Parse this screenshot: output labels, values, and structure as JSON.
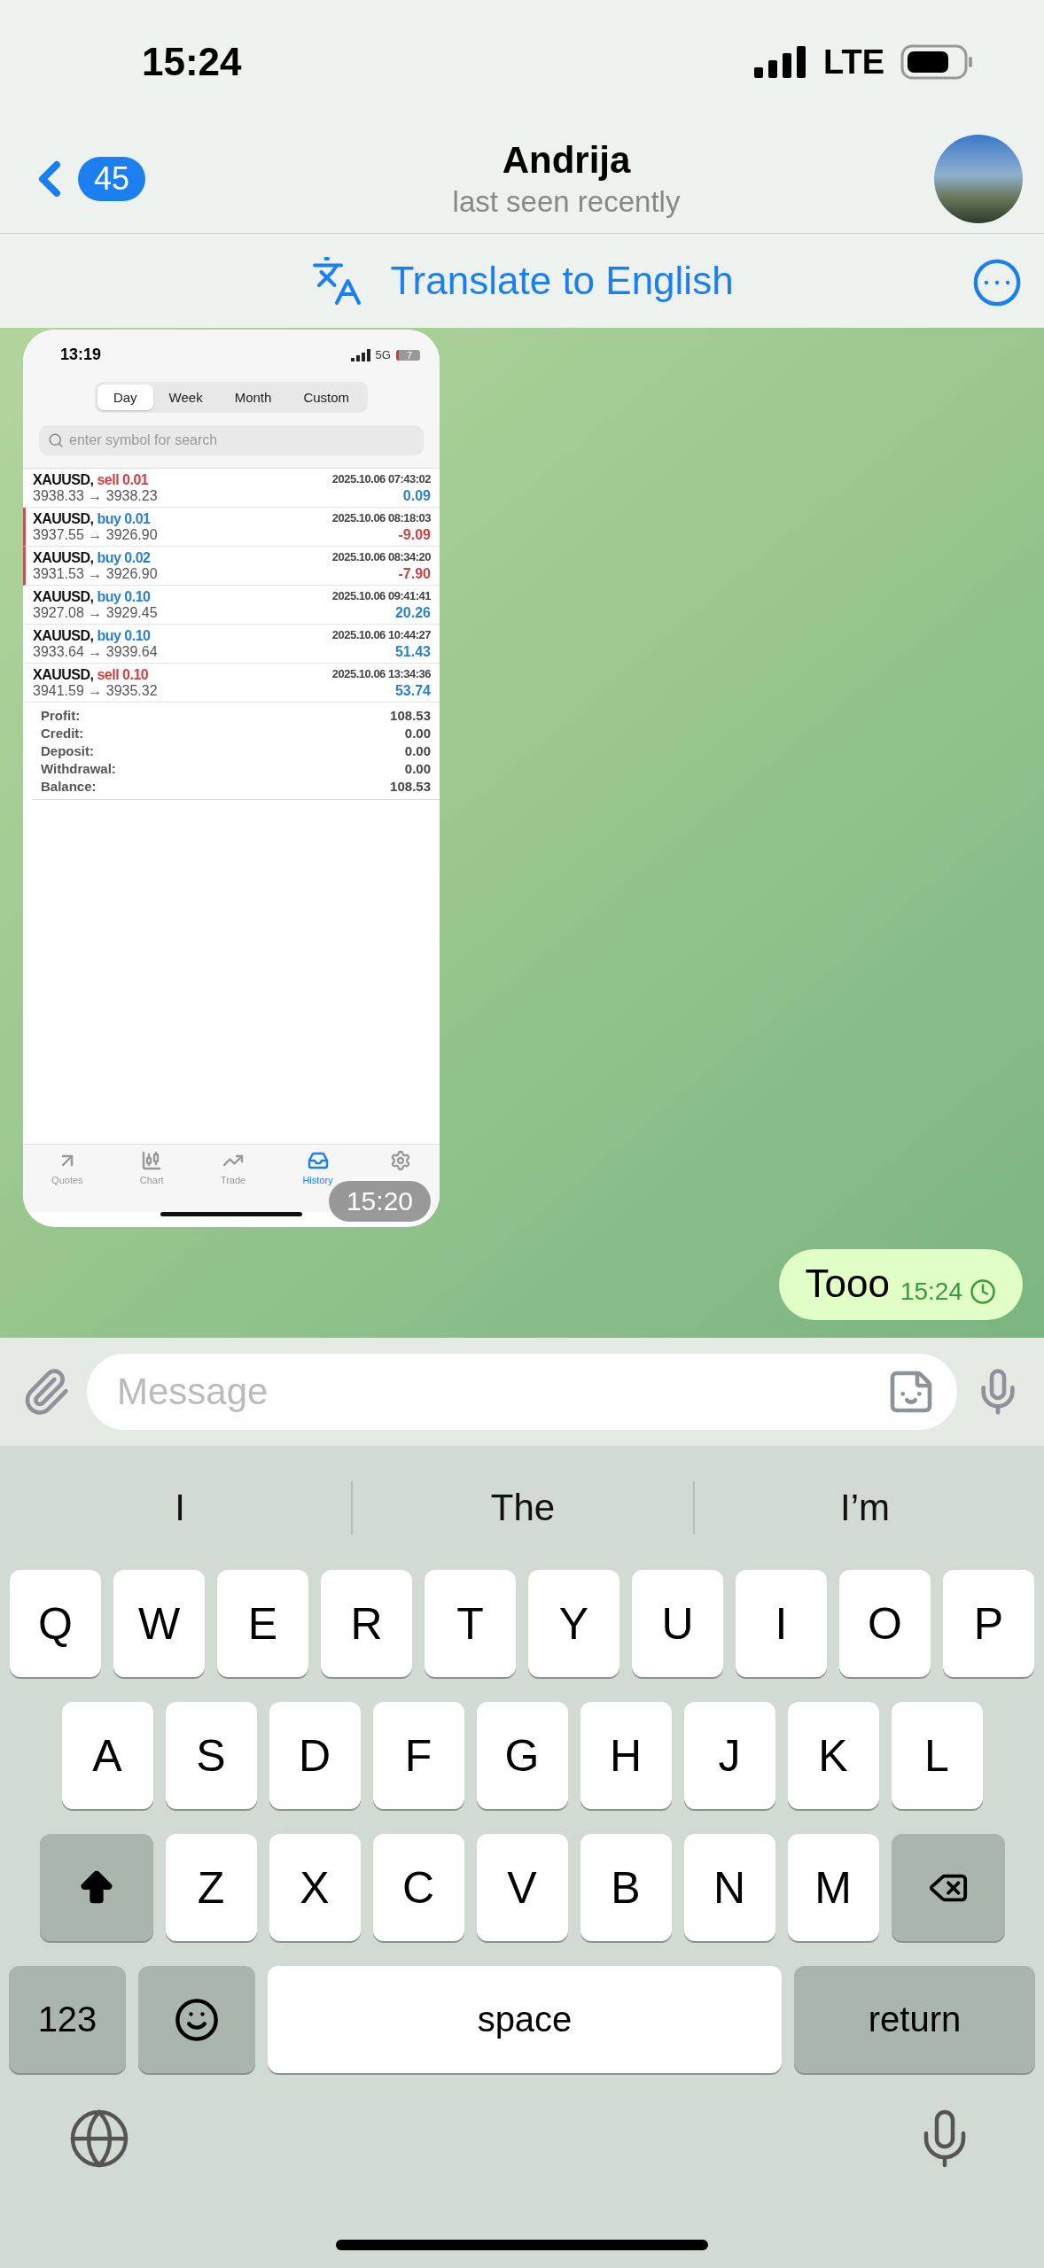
{
  "status_bar": {
    "time": "15:24",
    "network": "LTE"
  },
  "header": {
    "back_count": "45",
    "name": "Andrija",
    "subtitle": "last seen recently"
  },
  "translate_bar": {
    "label": "Translate to English"
  },
  "messages": [
    {
      "kind": "image",
      "time": "15:20",
      "screenshot": {
        "status_time": "13:19",
        "network": "5G",
        "battery": "7",
        "periods": [
          {
            "label": "Day",
            "selected": true
          },
          {
            "label": "Week",
            "selected": false
          },
          {
            "label": "Month",
            "selected": false
          },
          {
            "label": "Custom",
            "selected": false
          }
        ],
        "search": {
          "placeholder": "enter symbol for search"
        },
        "trades": [
          {
            "symbol": "XAUUSD,",
            "action": "sell 0.01",
            "is_sell": true,
            "time": "2025.10.06 07:43:02",
            "prices": "3938.33 → 3938.23",
            "profit": "0.09",
            "loss": false,
            "flagged": false
          },
          {
            "symbol": "XAUUSD,",
            "action": "buy 0.01",
            "is_sell": false,
            "time": "2025.10.06 08:18:03",
            "prices": "3937.55 → 3926.90",
            "profit": "-9.09",
            "loss": true,
            "flagged": true
          },
          {
            "symbol": "XAUUSD,",
            "action": "buy 0.02",
            "is_sell": false,
            "time": "2025.10.06 08:34:20",
            "prices": "3931.53 → 3926.90",
            "profit": "-7.90",
            "loss": true,
            "flagged": true
          },
          {
            "symbol": "XAUUSD,",
            "action": "buy 0.10",
            "is_sell": false,
            "time": "2025.10.06 09:41:41",
            "prices": "3927.08 → 3929.45",
            "profit": "20.26",
            "loss": false,
            "flagged": false
          },
          {
            "symbol": "XAUUSD,",
            "action": "buy 0.10",
            "is_sell": false,
            "time": "2025.10.06 10:44:27",
            "prices": "3933.64 → 3939.64",
            "profit": "51.43",
            "loss": false,
            "flagged": false
          },
          {
            "symbol": "XAUUSD,",
            "action": "sell 0.10",
            "is_sell": true,
            "time": "2025.10.06 13:34:36",
            "prices": "3941.59 → 3935.32",
            "profit": "53.74",
            "loss": false,
            "flagged": false
          }
        ],
        "summary": [
          {
            "label": "Profit:",
            "value": "108.53"
          },
          {
            "label": "Credit:",
            "value": "0.00"
          },
          {
            "label": "Deposit:",
            "value": "0.00"
          },
          {
            "label": "Withdrawal:",
            "value": "0.00"
          },
          {
            "label": "Balance:",
            "value": "108.53"
          }
        ],
        "tabs": [
          {
            "kind": "quotes",
            "label": "Quotes",
            "selected": false
          },
          {
            "kind": "chart",
            "label": "Chart",
            "selected": false
          },
          {
            "kind": "trade",
            "label": "Trade",
            "selected": false
          },
          {
            "kind": "history",
            "label": "History",
            "selected": true
          },
          {
            "kind": "settings",
            "selected": false
          }
        ]
      }
    },
    {
      "kind": "text",
      "text": "Tooo",
      "time": "15:24"
    }
  ],
  "composer": {
    "placeholder": "Message"
  },
  "suggestions": [
    "I",
    "The",
    "I’m"
  ],
  "keyboard": {
    "top_letters": [
      "Q",
      "W",
      "E",
      "R",
      "T",
      "Y",
      "U",
      "I",
      "O",
      "P"
    ],
    "middle_letters": [
      "A",
      "S",
      "D",
      "F",
      "G",
      "H",
      "J",
      "K",
      "L"
    ],
    "bottom_letters": [
      "Z",
      "X",
      "C",
      "V",
      "B",
      "N",
      "M"
    ],
    "numbers_key": "123",
    "space_key": "space",
    "return_key": "return"
  }
}
